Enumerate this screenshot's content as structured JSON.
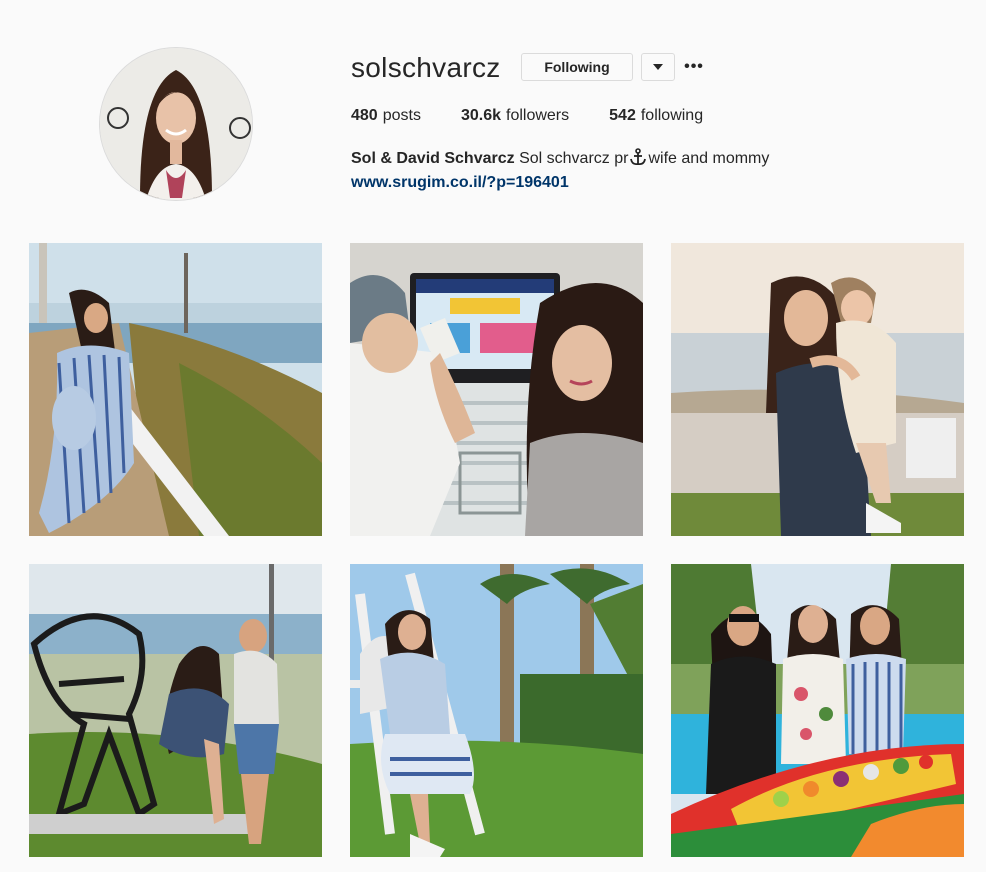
{
  "profile": {
    "username": "solschvarcz",
    "following_label": "Following",
    "dropdown_icon": "chevron-down-icon",
    "more_label": "•••",
    "stats": {
      "posts_count": "480",
      "posts_label": "posts",
      "followers_count": "30.6k",
      "followers_label": "followers",
      "following_count": "542",
      "following_label": "following"
    },
    "bio": {
      "name": "Sol & David Schvarcz",
      "text_before": "Sol schvarcz pr",
      "text_after": "wife and mommy",
      "link": "www.srugim.co.il/?p=196401"
    }
  },
  "posts": [
    {
      "name": "post-1",
      "subject": "pregnant woman in striped dress by seaside path"
    },
    {
      "name": "post-2",
      "subject": "child drinking in front of laptop with woman"
    },
    {
      "name": "post-3",
      "subject": "woman holding child by the sea"
    },
    {
      "name": "post-4",
      "subject": "couple kissing beside sculpture"
    },
    {
      "name": "post-5",
      "subject": "pregnant woman leaning on swing set"
    },
    {
      "name": "post-6",
      "subject": "three women with fruit boat platter"
    }
  ],
  "colors": {
    "link": "#003569",
    "border": "#dbdbdb",
    "background": "#fafafa"
  }
}
